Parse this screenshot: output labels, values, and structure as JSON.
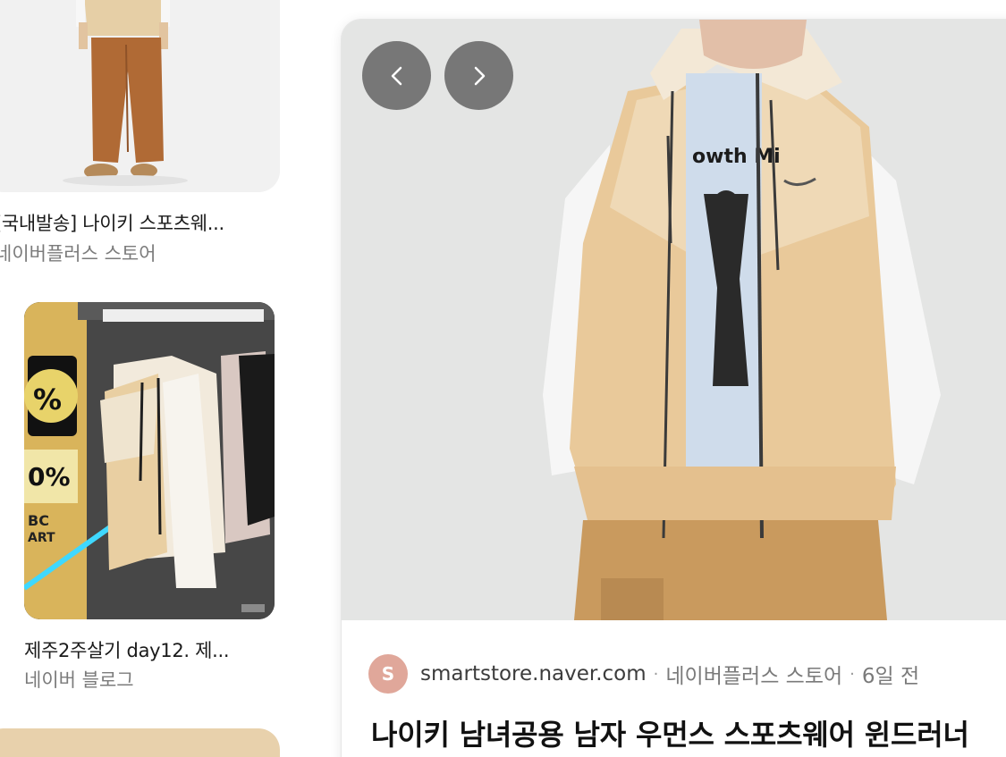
{
  "left_results": [
    {
      "title": "[국내발송] 나이키 스포츠웨...",
      "source": "네이버플러스 스토어"
    },
    {
      "title": "제주2주살기 day12. 제...",
      "source": "네이버 블로그"
    }
  ],
  "preview": {
    "nav_prev_icon": "chevron-left-icon",
    "nav_next_icon": "chevron-right-icon",
    "favicon_letter": "S",
    "domain": "smartstore.naver.com",
    "source": "네이버플러스 스토어",
    "age": "6일 전",
    "title": "나이키 남녀공용 남자 우먼스 스포츠웨어 윈드러너"
  },
  "colors": {
    "favicon_bg": "#e0a79a",
    "nav_button_bg": "#6e6e6e",
    "jacket_tan": "#e9c99a"
  }
}
